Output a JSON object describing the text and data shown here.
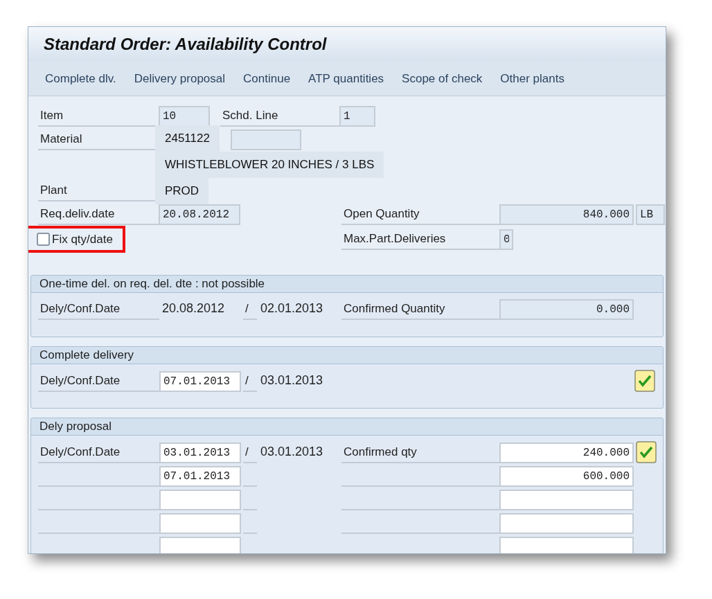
{
  "window": {
    "title": "Standard Order: Availability Control"
  },
  "toolbar": [
    "Complete dlv.",
    "Delivery proposal",
    "Continue",
    "ATP quantities",
    "Scope of check",
    "Other plants"
  ],
  "header": {
    "item": {
      "label": "Item",
      "value": "10"
    },
    "schedule_line": {
      "label": "Schd. Line",
      "value": "1"
    },
    "material": {
      "label": "Material"
    },
    "plant": {
      "label": "Plant"
    },
    "req_deliv_date": {
      "label": "Req.deliv.date",
      "value": "20.08.2012"
    },
    "open_quantity": {
      "label": "Open Quantity",
      "value": "840.000",
      "unit": "LB"
    },
    "fix_qty_date": {
      "label": "Fix qty/date",
      "checked": false,
      "highlighted": true
    },
    "max_part_deliveries": {
      "label": "Max.Part.Deliveries",
      "value": "0"
    }
  },
  "popup": {
    "lines": [
      "2451122",
      "WHISTLEBLOWER 20 INCHES / 3 LBS",
      "PROD"
    ]
  },
  "one_time": {
    "title": "One-time del. on req. del. dte : not possible",
    "label": "Dely/Conf.Date",
    "delivery_date": "20.08.2012",
    "separator": "/",
    "confirmed_date": "02.01.2013",
    "qty_label": "Confirmed Quantity",
    "qty": "0.000"
  },
  "complete_delivery": {
    "title": "Complete delivery",
    "label": "Dely/Conf.Date",
    "delivery_date": "07.01.2013",
    "separator": "/",
    "confirmed_date": "03.01.2013",
    "accepted": true
  },
  "proposal": {
    "title": "Dely proposal",
    "label": "Dely/Conf.Date",
    "qty_label": "Confirmed qty",
    "rows": [
      {
        "delivery_date": "03.01.2013",
        "separator": "/",
        "confirmed_date": "03.01.2013",
        "qty": "240.000",
        "accepted": true
      },
      {
        "delivery_date": "07.01.2013",
        "qty": "600.000",
        "accepted": false
      },
      {
        "accepted": false
      },
      {
        "accepted": false
      },
      {
        "accepted": false
      }
    ]
  }
}
